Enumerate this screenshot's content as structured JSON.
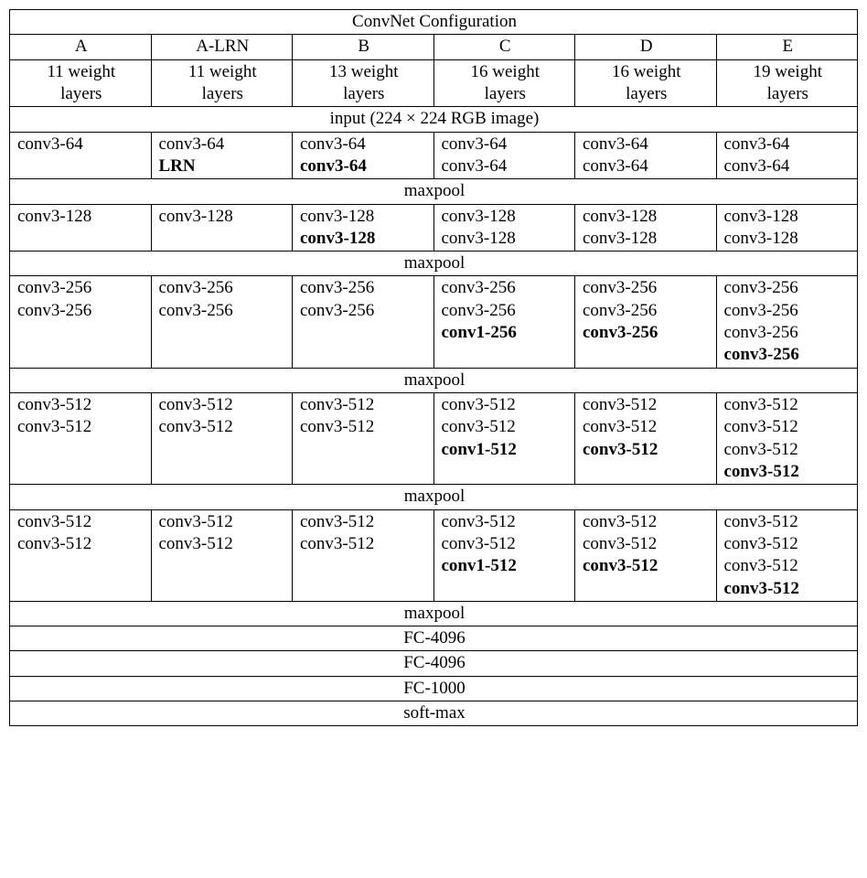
{
  "title": "ConvNet Configuration",
  "cols": [
    {
      "name": "A",
      "depth_l1": "11 weight",
      "depth_l2": "layers"
    },
    {
      "name": "A-LRN",
      "depth_l1": "11 weight",
      "depth_l2": "layers"
    },
    {
      "name": "B",
      "depth_l1": "13 weight",
      "depth_l2": "layers"
    },
    {
      "name": "C",
      "depth_l1": "16 weight",
      "depth_l2": "layers"
    },
    {
      "name": "D",
      "depth_l1": "16 weight",
      "depth_l2": "layers"
    },
    {
      "name": "E",
      "depth_l1": "19 weight",
      "depth_l2": "layers"
    }
  ],
  "input_row": "input (224 × 224 RGB image)",
  "pool": "maxpool",
  "fc": {
    "a": "FC-4096",
    "b": "FC-4096",
    "c": "FC-1000"
  },
  "softmax": "soft-max",
  "block1": {
    "A": [
      {
        "t": "conv3-64"
      }
    ],
    "ALRN": [
      {
        "t": "conv3-64"
      },
      {
        "t": "LRN",
        "b": true
      }
    ],
    "B": [
      {
        "t": "conv3-64"
      },
      {
        "t": "conv3-64",
        "b": true
      }
    ],
    "C": [
      {
        "t": "conv3-64"
      },
      {
        "t": "conv3-64"
      }
    ],
    "D": [
      {
        "t": "conv3-64"
      },
      {
        "t": "conv3-64"
      }
    ],
    "E": [
      {
        "t": "conv3-64"
      },
      {
        "t": "conv3-64"
      }
    ]
  },
  "block2": {
    "A": [
      {
        "t": "conv3-128"
      }
    ],
    "ALRN": [
      {
        "t": "conv3-128"
      }
    ],
    "B": [
      {
        "t": "conv3-128"
      },
      {
        "t": "conv3-128",
        "b": true
      }
    ],
    "C": [
      {
        "t": "conv3-128"
      },
      {
        "t": "conv3-128"
      }
    ],
    "D": [
      {
        "t": "conv3-128"
      },
      {
        "t": "conv3-128"
      }
    ],
    "E": [
      {
        "t": "conv3-128"
      },
      {
        "t": "conv3-128"
      }
    ]
  },
  "block3": {
    "A": [
      {
        "t": "conv3-256"
      },
      {
        "t": "conv3-256"
      }
    ],
    "ALRN": [
      {
        "t": "conv3-256"
      },
      {
        "t": "conv3-256"
      }
    ],
    "B": [
      {
        "t": "conv3-256"
      },
      {
        "t": "conv3-256"
      }
    ],
    "C": [
      {
        "t": "conv3-256"
      },
      {
        "t": "conv3-256"
      },
      {
        "t": "conv1-256",
        "b": true
      }
    ],
    "D": [
      {
        "t": "conv3-256"
      },
      {
        "t": "conv3-256"
      },
      {
        "t": "conv3-256",
        "b": true
      }
    ],
    "E": [
      {
        "t": "conv3-256"
      },
      {
        "t": "conv3-256"
      },
      {
        "t": "conv3-256"
      },
      {
        "t": "conv3-256",
        "b": true
      }
    ]
  },
  "block4": {
    "A": [
      {
        "t": "conv3-512"
      },
      {
        "t": "conv3-512"
      }
    ],
    "ALRN": [
      {
        "t": "conv3-512"
      },
      {
        "t": "conv3-512"
      }
    ],
    "B": [
      {
        "t": "conv3-512"
      },
      {
        "t": "conv3-512"
      }
    ],
    "C": [
      {
        "t": "conv3-512"
      },
      {
        "t": "conv3-512"
      },
      {
        "t": "conv1-512",
        "b": true
      }
    ],
    "D": [
      {
        "t": "conv3-512"
      },
      {
        "t": "conv3-512"
      },
      {
        "t": "conv3-512",
        "b": true
      }
    ],
    "E": [
      {
        "t": "conv3-512"
      },
      {
        "t": "conv3-512"
      },
      {
        "t": "conv3-512"
      },
      {
        "t": "conv3-512",
        "b": true
      }
    ]
  },
  "block5": {
    "A": [
      {
        "t": "conv3-512"
      },
      {
        "t": "conv3-512"
      }
    ],
    "ALRN": [
      {
        "t": "conv3-512"
      },
      {
        "t": "conv3-512"
      }
    ],
    "B": [
      {
        "t": "conv3-512"
      },
      {
        "t": "conv3-512"
      }
    ],
    "C": [
      {
        "t": "conv3-512"
      },
      {
        "t": "conv3-512"
      },
      {
        "t": "conv1-512",
        "b": true
      }
    ],
    "D": [
      {
        "t": "conv3-512"
      },
      {
        "t": "conv3-512"
      },
      {
        "t": "conv3-512",
        "b": true
      }
    ],
    "E": [
      {
        "t": "conv3-512"
      },
      {
        "t": "conv3-512"
      },
      {
        "t": "conv3-512"
      },
      {
        "t": "conv3-512",
        "b": true
      }
    ]
  }
}
